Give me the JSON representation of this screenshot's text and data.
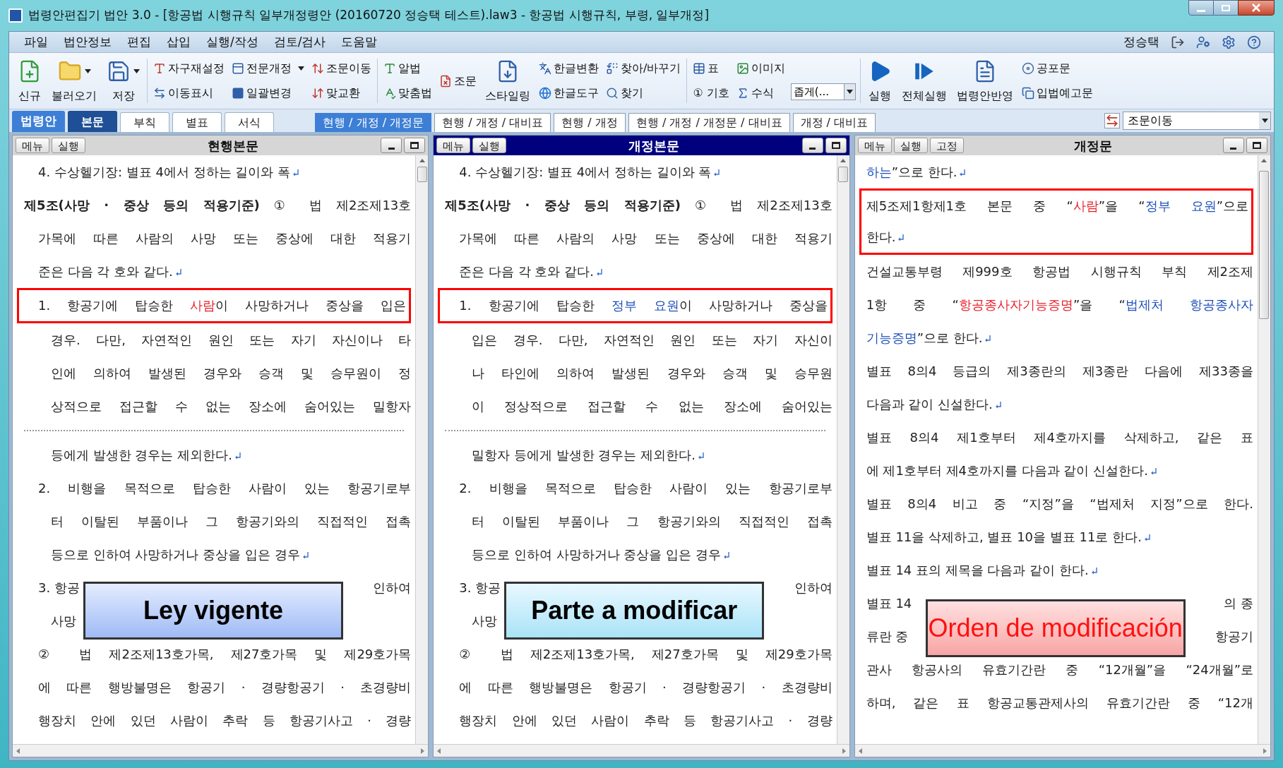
{
  "window": {
    "title": "법령안편집기 법안 3.0 - [항공법 시행규칙 일부개정령안 (20160720 정승택 테스트).law3 -  항공법 시행규칙, 부령, 일부개정]"
  },
  "menu": [
    "파일",
    "법안정보",
    "편집",
    "삽입",
    "실행/작성",
    "검토/검사",
    "도움말"
  ],
  "user": "정승택",
  "toolbar": [
    {
      "kind": "big",
      "label": "신규",
      "dropdown": false
    },
    {
      "kind": "big",
      "label": "불러오기",
      "dropdown": true
    },
    {
      "kind": "big",
      "label": "저장",
      "dropdown": true
    },
    {
      "kind": "separator"
    },
    {
      "kind": "stack",
      "items": [
        {
          "label": "자구재설정",
          "dropdown": false
        },
        {
          "label": "이동표시",
          "dropdown": false
        }
      ]
    },
    {
      "kind": "stack",
      "items": [
        {
          "label": "전문개정",
          "dropdown": true
        },
        {
          "label": "일괄변경",
          "dropdown": false
        }
      ]
    },
    {
      "kind": "stack",
      "items": [
        {
          "label": "조문이동",
          "dropdown": false
        },
        {
          "label": "맞교환",
          "dropdown": false
        }
      ]
    },
    {
      "kind": "separator"
    },
    {
      "kind": "stack",
      "items": [
        {
          "label": "알법",
          "dropdown": false
        },
        {
          "label": "맞춤법",
          "dropdown": false
        }
      ]
    },
    {
      "kind": "stack",
      "items": [
        {
          "label": "조문",
          "dropdown": false
        }
      ]
    },
    {
      "kind": "big",
      "label": "스타일링",
      "dropdown": false
    },
    {
      "kind": "stack",
      "items": [
        {
          "label": "한글변환",
          "dropdown": false
        },
        {
          "label": "한글도구",
          "dropdown": false
        }
      ]
    },
    {
      "kind": "stack",
      "items": [
        {
          "label": "찾아/바꾸기",
          "dropdown": false
        },
        {
          "label": "찾기",
          "dropdown": false
        }
      ]
    },
    {
      "kind": "separator"
    },
    {
      "kind": "stack",
      "items": [
        {
          "label": "표",
          "dropdown": false
        },
        {
          "label": "① 기호",
          "dropdown": false
        }
      ]
    },
    {
      "kind": "stack",
      "items": [
        {
          "label": "이미지",
          "dropdown": false
        },
        {
          "label": "수식",
          "dropdown": false
        }
      ]
    },
    {
      "kind": "combo",
      "value": "좁게(..."
    },
    {
      "kind": "separator"
    },
    {
      "kind": "big",
      "label": "실행",
      "dropdown": false
    },
    {
      "kind": "big",
      "label": "전체실행",
      "dropdown": false
    },
    {
      "kind": "big",
      "label": "법령안반영",
      "dropdown": false
    },
    {
      "kind": "stack",
      "items": [
        {
          "label": "공포문",
          "dropdown": false
        },
        {
          "label": "입법예고문",
          "dropdown": false
        }
      ]
    }
  ],
  "section_label": "법령안",
  "doc_tabs": [
    {
      "label": "본문",
      "selected": true
    },
    {
      "label": "부칙",
      "selected": false
    },
    {
      "label": "별표",
      "selected": false
    },
    {
      "label": "서식",
      "selected": false
    }
  ],
  "view_tabs": [
    {
      "label": "현행 / 개정 / 개정문",
      "selected": true
    },
    {
      "label": "현행 / 개정 / 대비표",
      "selected": false
    },
    {
      "label": "현행 / 개정",
      "selected": false
    },
    {
      "label": "현행 / 개정 / 개정문 / 대비표",
      "selected": false
    },
    {
      "label": "개정 / 대비표",
      "selected": false
    }
  ],
  "jump_combo": {
    "value": "조문이동"
  },
  "panels": [
    {
      "title": "현행본문",
      "active": false,
      "buttons": [
        "메뉴",
        "실행"
      ],
      "callout": {
        "text": "Ley vigente",
        "kind": "current"
      },
      "lines": [
        {
          "kind": "item",
          "boxed": false,
          "para_end": true,
          "segments": [
            {
              "text": "4. 수상헬기장: 별표 4에서 정하는 길이와 폭",
              "kind": "plain"
            }
          ]
        },
        {
          "kind": "flush",
          "boxed": false,
          "para_end": false,
          "segments": [
            {
              "text": "**제5조(사망 · 중상 등의 적용기준)** ① 법 제2조제13호",
              "kind": "plain"
            }
          ]
        },
        {
          "kind": "item",
          "boxed": false,
          "para_end": false,
          "segments": [
            {
              "text": "가목에 따른 사람의 사망 또는 중상에 대한 적용기",
              "kind": "plain"
            }
          ]
        },
        {
          "kind": "item",
          "boxed": false,
          "para_end": true,
          "segments": [
            {
              "text": "준은 다음 각 호와 같다.",
              "kind": "plain"
            }
          ]
        },
        {
          "kind": "item",
          "boxed": true,
          "para_end": false,
          "segments": [
            {
              "text": "1. 항공기에 탑승한 ",
              "kind": "plain"
            },
            {
              "text": "사람",
              "kind": "old"
            },
            {
              "text": "이 사망하거나 중상을 입은",
              "kind": "plain"
            }
          ]
        },
        {
          "kind": "wrapped",
          "boxed": false,
          "para_end": false,
          "segments": [
            {
              "text": "경우. 다만, 자연적인 원인 또는 자기 자신이나 타",
              "kind": "plain"
            }
          ]
        },
        {
          "kind": "wrapped",
          "boxed": false,
          "para_end": false,
          "segments": [
            {
              "text": "인에 의하여 발생된 경우와 승객 및 승무원이 정",
              "kind": "plain"
            }
          ]
        },
        {
          "kind": "wrapped",
          "boxed": false,
          "para_end": false,
          "segments": [
            {
              "text": "상적으로 접근할 수 없는 장소에 숨어있는 밀항자",
              "kind": "plain"
            }
          ]
        },
        {
          "kind": "page_break"
        },
        {
          "kind": "wrapped",
          "boxed": false,
          "para_end": true,
          "segments": [
            {
              "text": "등에게 발생한 경우는 제외한다.",
              "kind": "plain"
            }
          ]
        },
        {
          "kind": "item",
          "boxed": false,
          "para_end": false,
          "segments": [
            {
              "text": "2. 비행을 목적으로 탑승한 사람이 있는 항공기로부",
              "kind": "plain"
            }
          ]
        },
        {
          "kind": "wrapped",
          "boxed": false,
          "para_end": false,
          "segments": [
            {
              "text": "터 이탈된 부품이나 그 항공기와의 직접적인 접촉",
              "kind": "plain"
            }
          ]
        },
        {
          "kind": "wrapped",
          "boxed": false,
          "para_end": true,
          "segments": [
            {
              "text": "등으로 인하여 사망하거나 중상을 입은 경우",
              "kind": "plain"
            }
          ]
        },
        {
          "kind": "split_item",
          "parts": [
            "3. 항공",
            "인하여"
          ]
        },
        {
          "kind": "split_wrapped",
          "parts": [
            "사망"
          ]
        },
        {
          "kind": "item",
          "boxed": false,
          "para_end": false,
          "segments": [
            {
              "text": "② 법 제2조제13호가목, 제27호가목 및 제29호가목",
              "kind": "plain"
            }
          ]
        },
        {
          "kind": "item",
          "boxed": false,
          "para_end": false,
          "segments": [
            {
              "text": "에 따른 행방불명은 항공기 · 경량항공기 · 초경량비",
              "kind": "plain"
            }
          ]
        },
        {
          "kind": "item",
          "boxed": false,
          "para_end": false,
          "segments": [
            {
              "text": "행장치 안에 있던 사람이 추락 등 항공기사고 · 경량",
              "kind": "plain"
            }
          ]
        }
      ]
    },
    {
      "title": "개정본문",
      "active": true,
      "buttons": [
        "메뉴",
        "실행"
      ],
      "callout": {
        "text": "Parte a modificar",
        "kind": "draft"
      },
      "lines": [
        {
          "kind": "item",
          "boxed": false,
          "para_end": true,
          "segments": [
            {
              "text": "4. 수상헬기장: 별표 4에서 정하는 길이와 폭",
              "kind": "plain"
            }
          ]
        },
        {
          "kind": "flush",
          "boxed": false,
          "para_end": false,
          "segments": [
            {
              "text": "**제5조(사망 · 중상 등의 적용기준)** ① 법 제2조제13호",
              "kind": "plain"
            }
          ]
        },
        {
          "kind": "item",
          "boxed": false,
          "para_end": false,
          "segments": [
            {
              "text": "가목에 따른 사람의 사망 또는 중상에 대한 적용기",
              "kind": "plain"
            }
          ]
        },
        {
          "kind": "item",
          "boxed": false,
          "para_end": true,
          "segments": [
            {
              "text": "준은 다음 각 호와 같다.",
              "kind": "plain"
            }
          ]
        },
        {
          "kind": "item",
          "boxed": true,
          "para_end": false,
          "segments": [
            {
              "text": "1. 항공기에 탑승한 ",
              "kind": "plain"
            },
            {
              "text": "정부 요원",
              "kind": "new"
            },
            {
              "text": "이 사망하거나 중상을",
              "kind": "plain"
            }
          ]
        },
        {
          "kind": "wrapped",
          "boxed": false,
          "para_end": false,
          "segments": [
            {
              "text": "입은 경우. 다만, 자연적인 원인 또는 자기 자신이",
              "kind": "plain"
            }
          ]
        },
        {
          "kind": "wrapped",
          "boxed": false,
          "para_end": false,
          "segments": [
            {
              "text": "나 타인에 의하여 발생된 경우와 승객 및 승무원",
              "kind": "plain"
            }
          ]
        },
        {
          "kind": "wrapped",
          "boxed": false,
          "para_end": false,
          "segments": [
            {
              "text": "이 정상적으로 접근할 수 없는 장소에 숨어있는",
              "kind": "plain"
            }
          ]
        },
        {
          "kind": "page_break"
        },
        {
          "kind": "wrapped",
          "boxed": false,
          "para_end": true,
          "segments": [
            {
              "text": "밀항자 등에게 발생한 경우는 제외한다.",
              "kind": "plain"
            }
          ]
        },
        {
          "kind": "item",
          "boxed": false,
          "para_end": false,
          "segments": [
            {
              "text": "2. 비행을 목적으로 탑승한 사람이 있는 항공기로부",
              "kind": "plain"
            }
          ]
        },
        {
          "kind": "wrapped",
          "boxed": false,
          "para_end": false,
          "segments": [
            {
              "text": "터 이탈된 부품이나 그 항공기와의 직접적인 접촉",
              "kind": "plain"
            }
          ]
        },
        {
          "kind": "wrapped",
          "boxed": false,
          "para_end": true,
          "segments": [
            {
              "text": "등으로 인하여 사망하거나 중상을 입은 경우",
              "kind": "plain"
            }
          ]
        },
        {
          "kind": "split_item",
          "parts": [
            "3. 항공",
            "인하여"
          ]
        },
        {
          "kind": "split_wrapped",
          "parts": [
            "사망"
          ]
        },
        {
          "kind": "item",
          "boxed": false,
          "para_end": false,
          "segments": [
            {
              "text": "② 법 제2조제13호가목, 제27호가목 및 제29호가목",
              "kind": "plain"
            }
          ]
        },
        {
          "kind": "item",
          "boxed": false,
          "para_end": false,
          "segments": [
            {
              "text": "에 따른 행방불명은 항공기 · 경량항공기 · 초경량비",
              "kind": "plain"
            }
          ]
        },
        {
          "kind": "item",
          "boxed": false,
          "para_end": false,
          "segments": [
            {
              "text": "행장치 안에 있던 사람이 추락 등 항공기사고 · 경량",
              "kind": "plain"
            }
          ]
        }
      ]
    },
    {
      "title": "개정문",
      "active": false,
      "buttons": [
        "메뉴",
        "실행",
        "고정"
      ],
      "callout": {
        "text": "Orden de modificación",
        "kind": "order"
      },
      "lines": [
        {
          "kind": "flush",
          "boxed": false,
          "para_end": true,
          "segments": [
            {
              "text": "하는",
              "kind": "new"
            },
            {
              "text": "”으로 한다.",
              "kind": "plain"
            }
          ]
        },
        {
          "kind": "flush",
          "boxed": true,
          "para_end": false,
          "segments": [
            {
              "text": "제5조제1항제1호 본문 중 “",
              "kind": "plain"
            },
            {
              "text": "사람",
              "kind": "old"
            },
            {
              "text": "”을 “",
              "kind": "plain"
            },
            {
              "text": "정부 요원",
              "kind": "new"
            },
            {
              "text": "”으로",
              "kind": "plain"
            }
          ]
        },
        {
          "kind": "flush",
          "boxed": true,
          "para_end": true,
          "segments": [
            {
              "text": "한다.",
              "kind": "plain"
            }
          ]
        },
        {
          "kind": "flush",
          "boxed": false,
          "para_end": false,
          "segments": [
            {
              "text": "건설교통부령 제999호 항공법 시행규칙 부칙 제2조제",
              "kind": "plain"
            }
          ]
        },
        {
          "kind": "flush",
          "boxed": false,
          "para_end": false,
          "segments": [
            {
              "text": "1항 중 “",
              "kind": "plain"
            },
            {
              "text": "항공종사자기능증명",
              "kind": "old"
            },
            {
              "text": "”을 “",
              "kind": "plain"
            },
            {
              "text": "법제처 항공종사자",
              "kind": "new"
            }
          ]
        },
        {
          "kind": "flush",
          "boxed": false,
          "para_end": true,
          "segments": [
            {
              "text": "기능증명",
              "kind": "new"
            },
            {
              "text": "”으로 한다.",
              "kind": "plain"
            }
          ]
        },
        {
          "kind": "flush",
          "boxed": false,
          "para_end": false,
          "segments": [
            {
              "text": "별표 8의4 등급의 제3종란의 제3종란 다음에 제33종을",
              "kind": "plain"
            }
          ]
        },
        {
          "kind": "flush",
          "boxed": false,
          "para_end": true,
          "segments": [
            {
              "text": "다음과 같이 신설한다.",
              "kind": "plain"
            }
          ]
        },
        {
          "kind": "flush",
          "boxed": false,
          "para_end": false,
          "segments": [
            {
              "text": "별표 8의4 제1호부터 제4호까지를 삭제하고, 같은 표",
              "kind": "plain"
            }
          ]
        },
        {
          "kind": "flush",
          "boxed": false,
          "para_end": true,
          "segments": [
            {
              "text": "에 제1호부터 제4호까지를 다음과 같이 신설한다.",
              "kind": "plain"
            }
          ]
        },
        {
          "kind": "flush",
          "boxed": false,
          "para_end": false,
          "segments": [
            {
              "text": "별표 8의4 비고 중 “지정”을 “법제처 지정”으로 한다.",
              "kind": "plain"
            }
          ]
        },
        {
          "kind": "flush",
          "boxed": false,
          "para_end": true,
          "segments": [
            {
              "text": "별표 11을 삭제하고, 별표 10을 별표 11로 한다.",
              "kind": "plain"
            }
          ]
        },
        {
          "kind": "flush",
          "boxed": false,
          "para_end": true,
          "segments": [
            {
              "text": "별표 14 표의 제목을 다음과 같이 한다.",
              "kind": "plain"
            }
          ]
        },
        {
          "kind": "split_flush",
          "parts": [
            "별표 14",
            "의 종"
          ]
        },
        {
          "kind": "split_flush",
          "parts": [
            "류란 중",
            "항공기"
          ]
        },
        {
          "kind": "flush",
          "boxed": false,
          "para_end": false,
          "segments": [
            {
              "text": "관사 항공사의 유효기간란 중 “12개월”을 “24개월”로",
              "kind": "plain"
            }
          ]
        },
        {
          "kind": "flush",
          "boxed": false,
          "para_end": false,
          "segments": [
            {
              "text": "하며, 같은 표 항공교통관제사의 유효기간란 중 “12개",
              "kind": "plain"
            }
          ]
        }
      ]
    }
  ]
}
